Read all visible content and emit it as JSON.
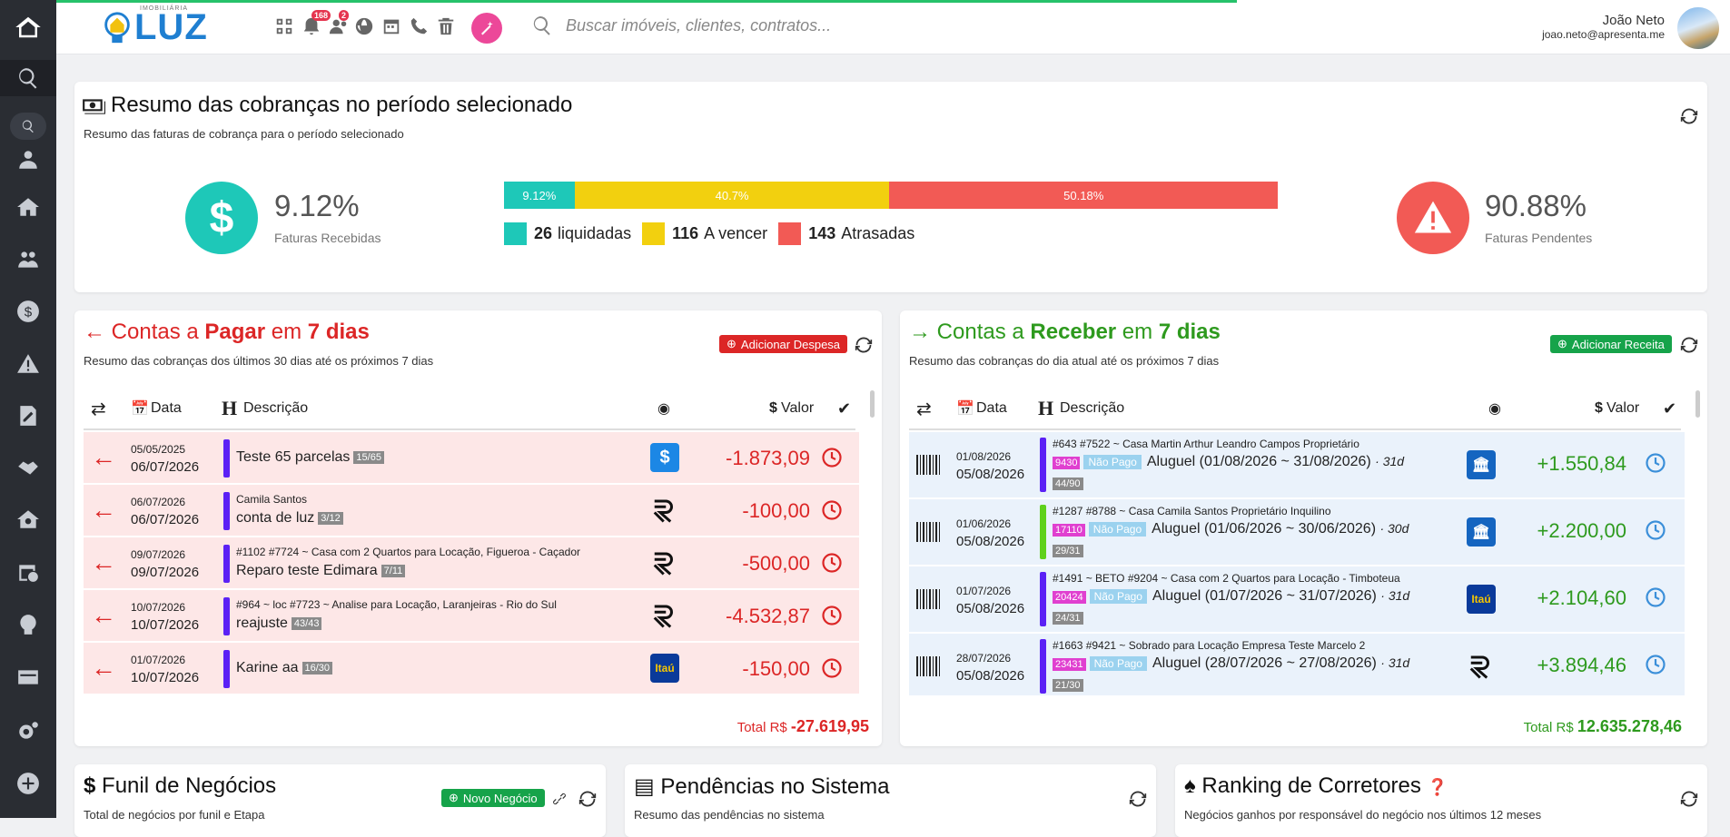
{
  "brand": {
    "name": "LUZ",
    "tagline": "IMOBILIÁRIA"
  },
  "topbar": {
    "notifications_count": "168",
    "users_count": "2",
    "search_placeholder": "Buscar imóveis, clientes, contratos...",
    "user_name": "João Neto",
    "user_email": "joao.neto@apresenta.me"
  },
  "summary": {
    "title": "Resumo das cobranças no período selecionado",
    "subtitle": "Resumo das faturas de cobrança para o período selecionado",
    "received_pct": "9.12%",
    "received_label": "Faturas Recebidas",
    "pending_pct": "90.88%",
    "pending_label": "Faturas Pendentes",
    "bar": [
      {
        "label": "9.12%",
        "value": 9.12,
        "color": "#1ec8b8"
      },
      {
        "label": "40.7%",
        "value": 40.7,
        "color": "#f2d00f"
      },
      {
        "label": "50.18%",
        "value": 50.18,
        "color": "#f25a55"
      }
    ],
    "legend": [
      {
        "count": "26",
        "label": "liquidadas",
        "color": "#1ec8b8"
      },
      {
        "count": "116",
        "label": "A vencer",
        "color": "#f2d00f"
      },
      {
        "count": "143",
        "label": "Atrasadas",
        "color": "#f25a55"
      }
    ]
  },
  "payables": {
    "title_a": "Contas a ",
    "title_b": "Pagar",
    "title_c": " em ",
    "title_d": "7 dias",
    "subtitle": "Resumo das cobranças dos últimos 30 dias até os próximos 7 dias",
    "add_label": "Adicionar Despesa",
    "col_date": "Data",
    "col_desc": "Descrição",
    "col_value": "Valor",
    "total_label": "Total R$",
    "total_value": "-27.619,95",
    "rows": [
      {
        "d1": "05/05/2025",
        "d2": "06/07/2026",
        "meta": "",
        "desc": "Teste 65 parcelas",
        "tag": "15/65",
        "value": "-1.873,09",
        "bank": "money"
      },
      {
        "d1": "06/07/2026",
        "d2": "06/07/2026",
        "meta": "Camila Santos",
        "desc": "conta de luz",
        "tag": "3/12",
        "value": "-100,00",
        "bank": "r"
      },
      {
        "d1": "09/07/2026",
        "d2": "09/07/2026",
        "meta": "#1102   #7724 ~ Casa com 2 Quartos para Locação, Figueroa - Caçador",
        "desc": "Reparo teste Edimara",
        "tag": "7/11",
        "value": "-500,00",
        "bank": "r"
      },
      {
        "d1": "10/07/2026",
        "d2": "10/07/2026",
        "meta": "#964 ~ loc   #7723 ~ Analise para Locação, Laranjeiras - Rio do Sul",
        "desc": "reajuste",
        "tag": "43/43",
        "value": "-4.532,87",
        "bank": "r"
      },
      {
        "d1": "01/07/2026",
        "d2": "10/07/2026",
        "meta": "",
        "desc": "Karine aa",
        "tag": "16/30",
        "value": "-150,00",
        "bank": "itau"
      }
    ]
  },
  "receivables": {
    "title_a": "Contas a ",
    "title_b": "Receber",
    "title_c": " em ",
    "title_d": "7 dias",
    "subtitle": "Resumo das cobranças do dia atual até os próximos 7 dias",
    "add_label": "Adicionar Receita",
    "col_date": "Data",
    "col_desc": "Descrição",
    "col_value": "Valor",
    "total_label": "Total R$",
    "total_value": "12.635.278,46",
    "rows": [
      {
        "d1": "01/08/2026",
        "d2": "05/08/2026",
        "meta": "#643   #7522 ~ Casa   Martin Arthur Leandro Campos   Proprietário",
        "code": "9430",
        "status": "Não Pago",
        "desc": "Aluguel (01/08/2026 ~ 31/08/2026)",
        "days": "· 31d",
        "tag": "44/90",
        "value": "+1.550,84",
        "bank": "bb",
        "line": "#5b21f5"
      },
      {
        "d1": "01/06/2026",
        "d2": "05/08/2026",
        "meta": "#1287   #8788 ~ Casa   Camila Santos   Proprietário   Inquilino",
        "code": "17110",
        "status": "Não Pago",
        "desc": "Aluguel (01/06/2026 ~ 30/06/2026)",
        "days": "· 30d",
        "tag": "29/31",
        "value": "+2.200,00",
        "bank": "bb",
        "line": "#5fd11b"
      },
      {
        "d1": "01/07/2026",
        "d2": "05/08/2026",
        "meta": "#1491 ~ BETO   #9204 ~ Casa com 2 Quartos para Locação - Timboteua",
        "code": "20424",
        "status": "Não Pago",
        "desc": "Aluguel (01/07/2026 ~ 31/07/2026)",
        "days": "· 31d",
        "tag": "24/31",
        "value": "+2.104,60",
        "bank": "itau",
        "line": "#5b21f5"
      },
      {
        "d1": "28/07/2026",
        "d2": "05/08/2026",
        "meta": "#1663   #9421 ~ Sobrado para Locação   Empresa Teste Marcelo 2",
        "code": "23431",
        "status": "Não Pago",
        "desc": "Aluguel (28/07/2026 ~ 27/08/2026)",
        "days": "· 31d",
        "tag": "21/30",
        "value": "+3.894,46",
        "bank": "r",
        "line": "#5b21f5"
      }
    ]
  },
  "funnel": {
    "title": "Funil de Negócios",
    "subtitle": "Total de negócios por funil e Etapa",
    "add_label": "Novo Negócio"
  },
  "pending": {
    "title": "Pendências no Sistema",
    "subtitle": "Resumo das pendências no sistema"
  },
  "ranking": {
    "title": "Ranking de Corretores",
    "subtitle": "Negócios ganhos por responsável do negócio nos últimos 12 meses"
  }
}
